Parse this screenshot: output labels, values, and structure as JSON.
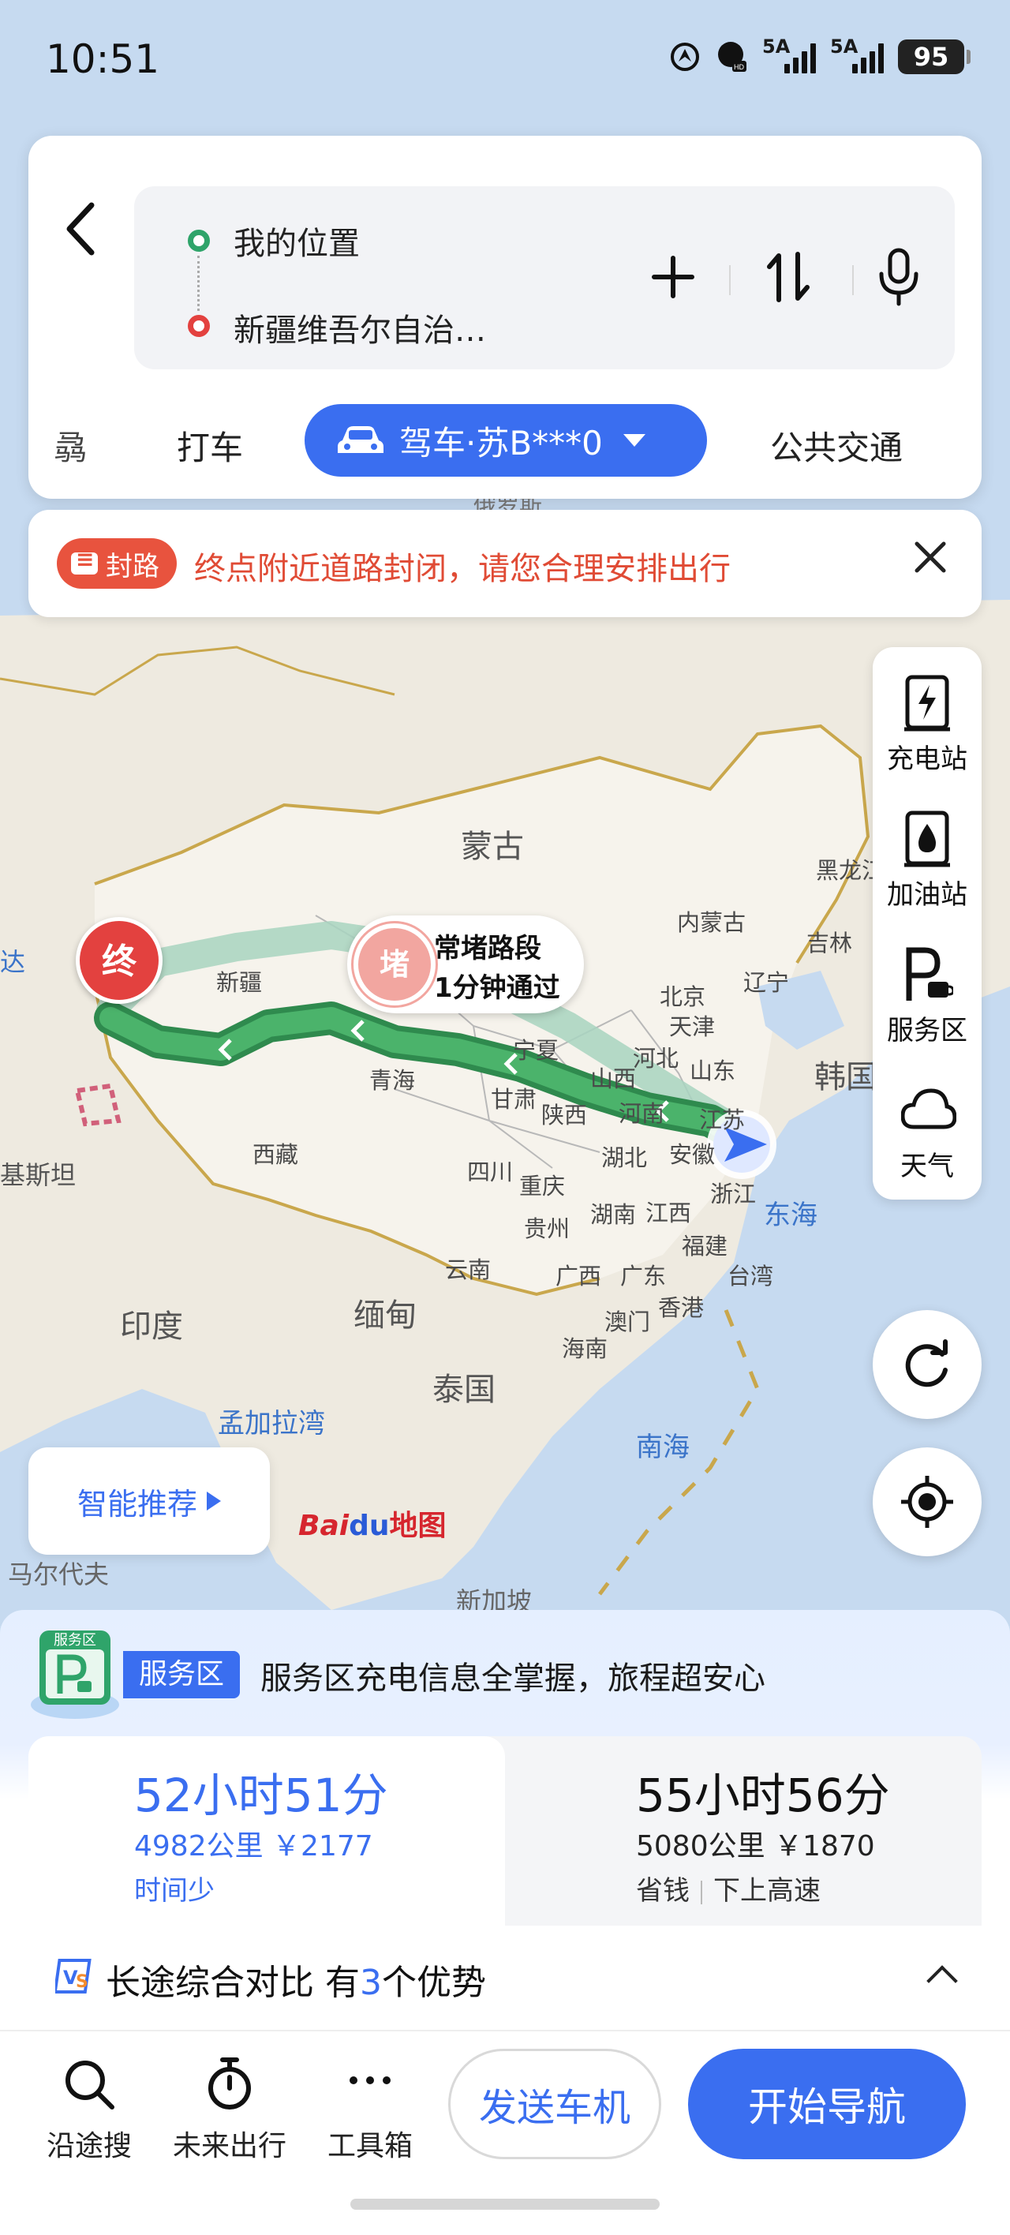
{
  "status": {
    "time": "10:51",
    "battery": "95",
    "signal1": "5A",
    "signal2": "5A"
  },
  "route": {
    "origin": "我的位置",
    "destination": "新疆维吾尔自治…"
  },
  "modes": {
    "partial": "骉",
    "taxi": "打车",
    "drive": "驾车·苏B***0",
    "transit": "公共交通"
  },
  "closure": {
    "badge": "封路",
    "message": "终点附近道路封闭，请您合理安排出行"
  },
  "tools": {
    "charging": "充电站",
    "gas": "加油站",
    "service": "服务区",
    "weather": "天气"
  },
  "map": {
    "labels": {
      "mongolia": "蒙古",
      "xinjiang": "新疆",
      "neimenggu": "内蒙古",
      "heilongjiang": "黑龙江",
      "jilin": "吉林",
      "liaoning": "辽宁",
      "beijing": "北京",
      "tianjin": "天津",
      "hebei": "河北",
      "ningxia": "宁夏",
      "shanxi": "山西",
      "shandong": "山东",
      "qinghai": "青海",
      "gansu": "甘肃",
      "shaanxi": "陕西",
      "henan": "河南",
      "jiangsu": "江苏",
      "anhui": "安徽",
      "hubei": "湖北",
      "xizang": "西藏",
      "sichuan": "四川",
      "chongqing": "重庆",
      "zhejiang": "浙江",
      "hunan": "湖南",
      "jiangxi": "江西",
      "guizhou": "贵州",
      "fujian": "福建",
      "yunnan": "云南",
      "guangxi": "广西",
      "guangdong": "广东",
      "taiwan": "台湾",
      "hongkong": "香港",
      "macau": "澳门",
      "hainan": "海南",
      "korea": "韩国",
      "eastsea": "东海",
      "india": "印度",
      "myanmar": "缅甸",
      "thailand": "泰国",
      "bengal": "孟加拉湾",
      "southsea": "南海",
      "maldives": "马尔代夫",
      "singapore": "新加坡",
      "pakistan": "基斯坦",
      "da": "达",
      "topcut": "俄罗斯"
    },
    "end_pin": "终",
    "jam": {
      "icon": "堵",
      "line1": "常堵路段",
      "line2": "1分钟通过"
    },
    "smart": "智能推荐",
    "baidu": "Bai",
    "baidu_du": "du",
    "baidu_map": "地图"
  },
  "sheet": {
    "promo_tag": "服务区",
    "promo_icon_label": "服务区",
    "promo_text": "服务区充电信息全掌握，旅程超安心",
    "routes": [
      {
        "time": "52小时51分",
        "distance": "4982公里  ￥2177",
        "tags": [
          "时间少"
        ]
      },
      {
        "time": "55小时56分",
        "distance": "5080公里  ￥1870",
        "tags": [
          "省钱",
          "下上高速"
        ]
      }
    ],
    "compare_prefix": "长途综合对比 有",
    "compare_num": "3",
    "compare_suffix": "个优势"
  },
  "bottom": {
    "along": "沿途搜",
    "future": "未来出行",
    "tools": "工具箱",
    "send": "发送车机",
    "start": "开始导航"
  },
  "colors": {
    "accent": "#3a6ef0",
    "route_main": "#3a9a5a",
    "route_alt": "#9fd0b8",
    "closure": "#e04b35"
  }
}
